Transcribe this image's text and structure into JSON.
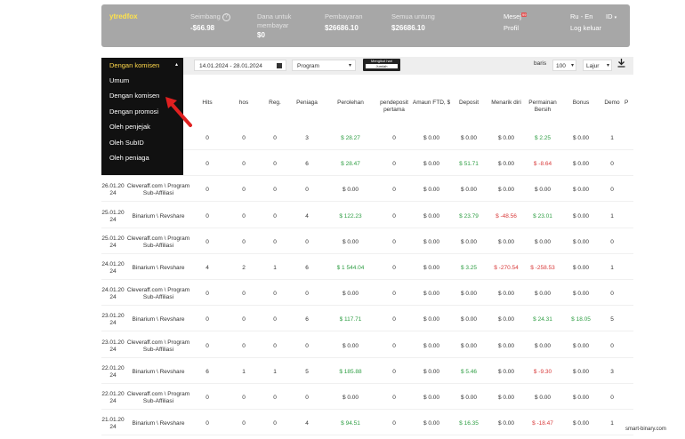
{
  "header": {
    "brand": "ytredfox",
    "balance_label": "Seimbang",
    "balance_value": "-$66.98",
    "withdraw_label_1": "Dana untuk",
    "withdraw_label_2": "membayar",
    "withdraw_value": "$0",
    "payments_label": "Pembayaran",
    "payments_value": "$26686.10",
    "profit_label": "Semua untung",
    "profit_value": "$26686.10",
    "messages_label": "Mesej",
    "messages_badge": "99",
    "profile_label": "Profil",
    "lang_ru": "Ru",
    "lang_sep": "-",
    "lang_en": "En",
    "id_label": "ID",
    "logout_label": "Log keluar"
  },
  "filters": {
    "date_range": "14.01.2024 - 28.01.2024",
    "program_select": "Program",
    "tooltip_line1": "Mengikut hari",
    "tooltip_line2": "Jumlah",
    "rows_label": "baris",
    "rows_value": "100",
    "columns_select": "Lajur"
  },
  "dropdown": {
    "selected": "Dengan komisen",
    "items": [
      "Umum",
      "Dengan komisen",
      "Dengan promosi",
      "Oleh penjejak",
      "Oleh SubID",
      "Oleh peniaga"
    ]
  },
  "table": {
    "headers": [
      "Hits",
      "hos",
      "Reg.",
      "Peniaga",
      "Perolehan",
      "pendeposit pertama",
      "Amaun FTD, $",
      "Deposit",
      "Menarik diri",
      "Permainan Bersih",
      "Bonus",
      "Demo",
      "P"
    ],
    "rows": [
      {
        "date": "",
        "program": "",
        "hits": "0",
        "hos": "0",
        "reg": "0",
        "peniaga": "3",
        "perolehan": [
          "g",
          "$ 28.27"
        ],
        "ftd": "0",
        "amaun": "$ 0.00",
        "deposit": [
          "",
          "$ 0.00"
        ],
        "menarik": [
          "",
          "$ 0.00"
        ],
        "permainan": [
          "g",
          "$ 2.25"
        ],
        "bonus": "$ 0.00",
        "demo": "1"
      },
      {
        "date": "",
        "program": "",
        "hits": "0",
        "hos": "0",
        "reg": "0",
        "peniaga": "6",
        "perolehan": [
          "g",
          "$ 28.47"
        ],
        "ftd": "0",
        "amaun": "$ 0.00",
        "deposit": [
          "g",
          "$ 51.71"
        ],
        "menarik": [
          "",
          "$ 0.00"
        ],
        "permainan": [
          "r",
          "$ -8.64"
        ],
        "bonus": "$ 0.00",
        "demo": "0"
      },
      {
        "date": "26.01.20 24",
        "program": "Cleveraff.com \\ Program Sub-Affiliasi",
        "hits": "0",
        "hos": "0",
        "reg": "0",
        "peniaga": "0",
        "perolehan": [
          "",
          "$ 0.00"
        ],
        "ftd": "0",
        "amaun": "$ 0.00",
        "deposit": [
          "",
          "$ 0.00"
        ],
        "menarik": [
          "",
          "$ 0.00"
        ],
        "permainan": [
          "",
          "$ 0.00"
        ],
        "bonus": "$ 0.00",
        "demo": "0"
      },
      {
        "date": "25.01.20 24",
        "program": "Binarium \\ Revshare",
        "hits": "0",
        "hos": "0",
        "reg": "0",
        "peniaga": "4",
        "perolehan": [
          "g",
          "$ 122.23"
        ],
        "ftd": "0",
        "amaun": "$ 0.00",
        "deposit": [
          "g",
          "$ 23.79"
        ],
        "menarik": [
          "r",
          "$ -48.56"
        ],
        "permainan": [
          "g",
          "$ 23.01"
        ],
        "bonus": "$ 0.00",
        "demo": "1"
      },
      {
        "date": "25.01.20 24",
        "program": "Cleveraff.com \\ Program Sub-Affiliasi",
        "hits": "0",
        "hos": "0",
        "reg": "0",
        "peniaga": "0",
        "perolehan": [
          "",
          "$ 0.00"
        ],
        "ftd": "0",
        "amaun": "$ 0.00",
        "deposit": [
          "",
          "$ 0.00"
        ],
        "menarik": [
          "",
          "$ 0.00"
        ],
        "permainan": [
          "",
          "$ 0.00"
        ],
        "bonus": "$ 0.00",
        "demo": "0"
      },
      {
        "date": "24.01.20 24",
        "program": "Binarium \\ Revshare",
        "hits": "4",
        "hos": "2",
        "reg": "1",
        "peniaga": "6",
        "perolehan": [
          "g",
          "$ 1 544.04"
        ],
        "ftd": "0",
        "amaun": "$ 0.00",
        "deposit": [
          "g",
          "$ 3.25"
        ],
        "menarik": [
          "r",
          "$ -270.54"
        ],
        "permainan": [
          "r",
          "$ -258.53"
        ],
        "bonus": "$ 0.00",
        "demo": "1"
      },
      {
        "date": "24.01.20 24",
        "program": "Cleveraff.com \\ Program Sub-Affiliasi",
        "hits": "0",
        "hos": "0",
        "reg": "0",
        "peniaga": "0",
        "perolehan": [
          "",
          "$ 0.00"
        ],
        "ftd": "0",
        "amaun": "$ 0.00",
        "deposit": [
          "",
          "$ 0.00"
        ],
        "menarik": [
          "",
          "$ 0.00"
        ],
        "permainan": [
          "",
          "$ 0.00"
        ],
        "bonus": "$ 0.00",
        "demo": "0"
      },
      {
        "date": "23.01.20 24",
        "program": "Binarium \\ Revshare",
        "hits": "0",
        "hos": "0",
        "reg": "0",
        "peniaga": "6",
        "perolehan": [
          "g",
          "$ 117.71"
        ],
        "ftd": "0",
        "amaun": "$ 0.00",
        "deposit": [
          "",
          "$ 0.00"
        ],
        "menarik": [
          "",
          "$ 0.00"
        ],
        "permainan": [
          "g",
          "$ 24.31"
        ],
        "bonus": "$ 18.05",
        "bonus_g": true,
        "demo": "5"
      },
      {
        "date": "23.01.20 24",
        "program": "Cleveraff.com \\ Program Sub-Affiliasi",
        "hits": "0",
        "hos": "0",
        "reg": "0",
        "peniaga": "0",
        "perolehan": [
          "",
          "$ 0.00"
        ],
        "ftd": "0",
        "amaun": "$ 0.00",
        "deposit": [
          "",
          "$ 0.00"
        ],
        "menarik": [
          "",
          "$ 0.00"
        ],
        "permainan": [
          "",
          "$ 0.00"
        ],
        "bonus": "$ 0.00",
        "demo": "0"
      },
      {
        "date": "22.01.20 24",
        "program": "Binarium \\ Revshare",
        "hits": "6",
        "hos": "1",
        "reg": "1",
        "peniaga": "5",
        "perolehan": [
          "g",
          "$ 185.88"
        ],
        "ftd": "0",
        "amaun": "$ 0.00",
        "deposit": [
          "g",
          "$ 5.46"
        ],
        "menarik": [
          "",
          "$ 0.00"
        ],
        "permainan": [
          "r",
          "$ -9.30"
        ],
        "bonus": "$ 0.00",
        "demo": "3"
      },
      {
        "date": "22.01.20 24",
        "program": "Cleveraff.com \\ Program Sub-Affiliasi",
        "hits": "0",
        "hos": "0",
        "reg": "0",
        "peniaga": "0",
        "perolehan": [
          "",
          "$ 0.00"
        ],
        "ftd": "0",
        "amaun": "$ 0.00",
        "deposit": [
          "",
          "$ 0.00"
        ],
        "menarik": [
          "",
          "$ 0.00"
        ],
        "permainan": [
          "",
          "$ 0.00"
        ],
        "bonus": "$ 0.00",
        "demo": "0"
      },
      {
        "date": "21.01.20 24",
        "program": "Binarium \\ Revshare",
        "hits": "0",
        "hos": "0",
        "reg": "0",
        "peniaga": "4",
        "perolehan": [
          "g",
          "$ 94.51"
        ],
        "ftd": "0",
        "amaun": "$ 0.00",
        "deposit": [
          "g",
          "$ 16.35"
        ],
        "menarik": [
          "",
          "$ 0.00"
        ],
        "permainan": [
          "r",
          "$ -18.47"
        ],
        "bonus": "$ 0.00",
        "demo": "1"
      }
    ]
  },
  "watermark": "smart-binary.com",
  "colors": {
    "header_bg": "#a7a7a7",
    "brand": "#ffe34a",
    "dropdown_bg": "#111111",
    "dropdown_selected": "#ffd84a",
    "positive": "#2f9e44",
    "negative": "#d83a3a",
    "arrow": "#e02020"
  }
}
